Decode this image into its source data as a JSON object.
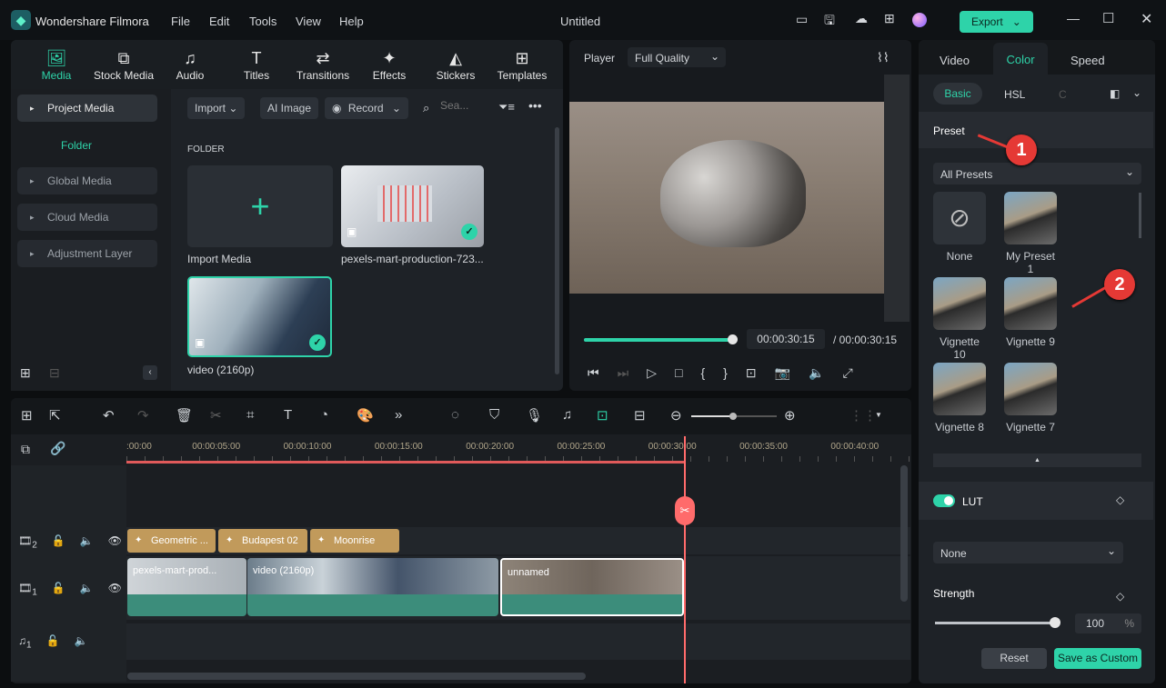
{
  "app": {
    "name": "Wondershare Filmora",
    "title": "Untitled",
    "menu": [
      "File",
      "Edit",
      "Tools",
      "View",
      "Help"
    ],
    "export_label": "Export",
    "accent": "#2ed3a9"
  },
  "nav_tabs": [
    {
      "label": "Media",
      "icon": "media-icon",
      "active": true
    },
    {
      "label": "Stock Media",
      "icon": "stock-media-icon"
    },
    {
      "label": "Audio",
      "icon": "music-note-icon"
    },
    {
      "label": "Titles",
      "icon": "text-t-icon"
    },
    {
      "label": "Transitions",
      "icon": "transitions-icon"
    },
    {
      "label": "Effects",
      "icon": "effects-star-icon"
    },
    {
      "label": "Stickers",
      "icon": "stickers-icon"
    },
    {
      "label": "Templates",
      "icon": "templates-icon"
    }
  ],
  "sidebar": {
    "project_media": "Project Media",
    "folder": "Folder",
    "items": [
      "Global Media",
      "Cloud Media",
      "Adjustment Layer"
    ]
  },
  "media_toolbar": {
    "import": "Import",
    "ai_image": "AI Image",
    "record": "Record",
    "search_placeholder": "Sea..."
  },
  "media": {
    "folder_label": "FOLDER",
    "items": [
      {
        "label": "Import Media"
      },
      {
        "label": "pexels-mart-production-723..."
      },
      {
        "label": "video (2160p)"
      }
    ]
  },
  "player": {
    "label": "Player",
    "quality": "Full Quality",
    "current_time": "00:00:30:15",
    "total_time": "/ 00:00:30:15",
    "progress": 1.0
  },
  "timeline": {
    "ticks": [
      ":00:00",
      "00:00:05:00",
      "00:00:10:00",
      "00:00:15:00",
      "00:00:20:00",
      "00:00:25:00",
      "00:00:30:00",
      "00:00:35:00",
      "00:00:40:00"
    ],
    "track2_clips": [
      "Geometric ...",
      "Budapest 02",
      "Moonrise"
    ],
    "track1_clips": [
      "pexels-mart-prod...",
      "video (2160p)",
      "unnamed"
    ],
    "track_labels": {
      "v2": "2",
      "v1": "1",
      "a1": "1"
    }
  },
  "right": {
    "tabs": [
      "Video",
      "Color",
      "Speed"
    ],
    "active_tab": "Color",
    "subtabs": [
      "Basic",
      "HSL",
      "C"
    ],
    "preset_label": "Preset",
    "preset_select": "All Presets",
    "presets": [
      "None",
      "My Preset 1",
      "Vignette 10",
      "Vignette 9",
      "Vignette 8",
      "Vignette 7"
    ],
    "lut_label": "LUT",
    "lut_enabled": true,
    "lut_value": "None",
    "strength_label": "Strength",
    "strength_value": "100",
    "strength_unit": "%",
    "reset": "Reset",
    "save_custom": "Save as Custom"
  },
  "annotations": [
    "1",
    "2"
  ]
}
